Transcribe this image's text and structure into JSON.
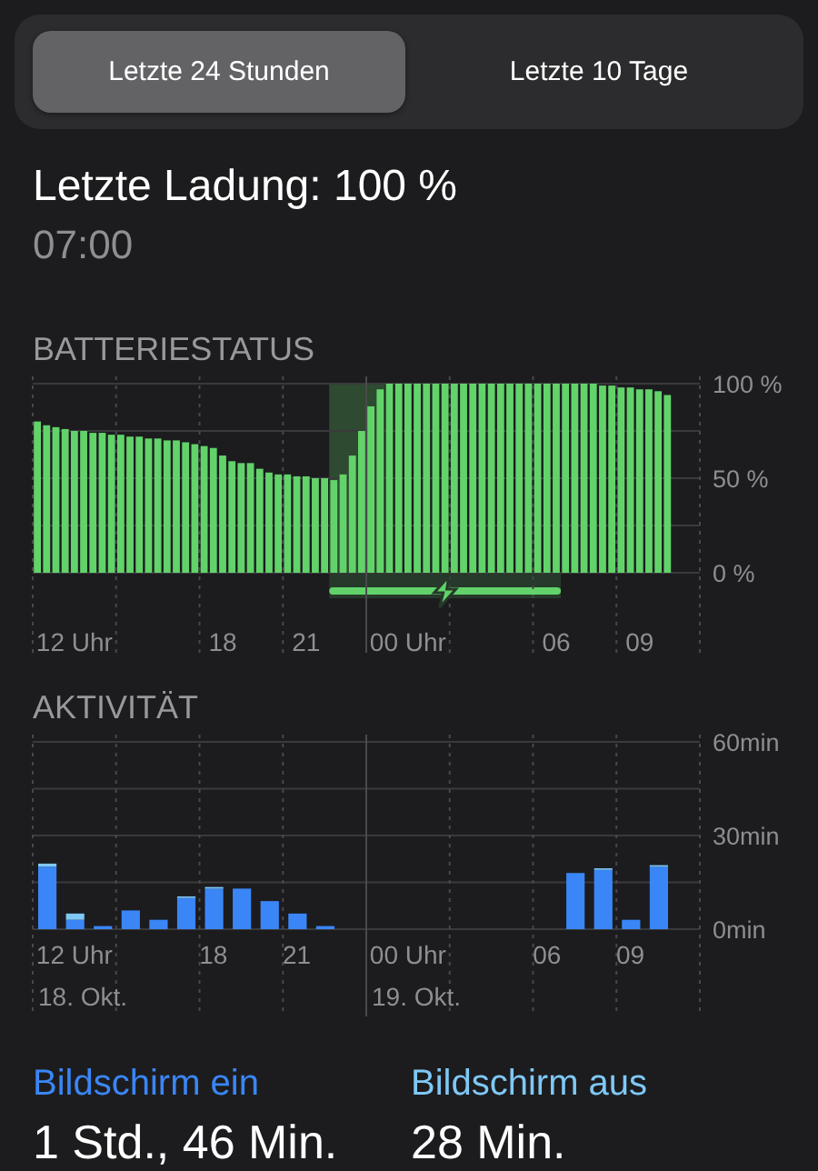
{
  "tabs": [
    {
      "label": "Letzte 24 Stunden",
      "selected": true
    },
    {
      "label": "Letzte 10 Tage",
      "selected": false
    }
  ],
  "last_charge": {
    "title": "Letzte Ladung: 100 %",
    "time": "07:00"
  },
  "battery": {
    "heading": "BATTERIESTATUS",
    "charging": true,
    "chart_data": {
      "type": "bar",
      "categories": [
        null,
        null,
        null,
        null,
        "12 Uhr",
        null,
        null,
        null,
        null,
        null,
        null,
        null,
        null,
        null,
        null,
        null,
        null,
        null,
        null,
        null,
        "18",
        null,
        null,
        null,
        null,
        null,
        null,
        null,
        null,
        "21",
        null,
        null,
        null,
        null,
        null,
        null,
        null,
        null,
        null,
        null,
        "00 Uhr",
        null,
        null,
        null,
        null,
        null,
        null,
        null,
        null,
        null,
        null,
        null,
        null,
        null,
        null,
        null,
        "06",
        null,
        null,
        null,
        null,
        null,
        null,
        null,
        null,
        "09",
        null,
        null,
        null,
        null,
        null,
        null
      ],
      "series": [
        {
          "color": "#62d36a",
          "values": [
            80,
            78,
            77,
            76,
            75,
            75,
            74,
            74,
            73,
            73,
            72,
            72,
            71,
            71,
            70,
            70,
            69,
            68,
            67,
            66,
            62,
            59,
            58,
            58,
            55,
            53,
            52,
            52,
            51,
            51,
            50,
            50,
            49,
            52,
            62,
            75,
            88,
            97,
            100,
            100,
            100,
            100,
            100,
            100,
            100,
            100,
            100,
            100,
            100,
            100,
            100,
            100,
            100,
            100,
            100,
            100,
            100,
            100,
            100,
            100,
            100,
            99,
            99,
            98,
            98,
            97,
            97,
            96,
            94,
            null,
            null,
            null
          ]
        }
      ],
      "ylim": [
        0,
        100
      ],
      "yticks": [
        {
          "value": 100,
          "label": "100 %"
        },
        {
          "value": 50,
          "label": "50 %"
        },
        {
          "value": 0,
          "label": "0 %"
        }
      ]
    }
  },
  "activity": {
    "heading": "AKTIVITÄT",
    "chart_data": {
      "type": "bar",
      "stacked": true,
      "categories": [
        null,
        "12 Uhr",
        null,
        null,
        null,
        null,
        "18",
        null,
        null,
        "21",
        null,
        null,
        null,
        "00 Uhr",
        null,
        null,
        null,
        null,
        "06",
        null,
        null,
        "09",
        null,
        null
      ],
      "series": [
        {
          "name": "Bildschirm ein",
          "color": "#3a86f6",
          "values": [
            20,
            3,
            1,
            6,
            3,
            10,
            13,
            13,
            9,
            5,
            1,
            0,
            0,
            0,
            0,
            0,
            0,
            0,
            0,
            18,
            19,
            3,
            20,
            null
          ]
        },
        {
          "name": "Bildschirm aus",
          "color": "#7fc8f6",
          "values": [
            1,
            2,
            0,
            0,
            0,
            0.5,
            0.5,
            0,
            0,
            0,
            0,
            0,
            0,
            0,
            0,
            0,
            0,
            0,
            0,
            0,
            0.5,
            0,
            0.5,
            null
          ]
        }
      ],
      "ylim": [
        0,
        60
      ],
      "yticks": [
        {
          "value": 60,
          "label": "60min"
        },
        {
          "value": 30,
          "label": "30min"
        },
        {
          "value": 0,
          "label": "0min"
        }
      ],
      "annotations": [
        "18. Okt.",
        "19. Okt."
      ]
    }
  },
  "summary": [
    {
      "value": "1 Std., 46 Min."
    },
    {
      "value": "28 Min."
    }
  ]
}
